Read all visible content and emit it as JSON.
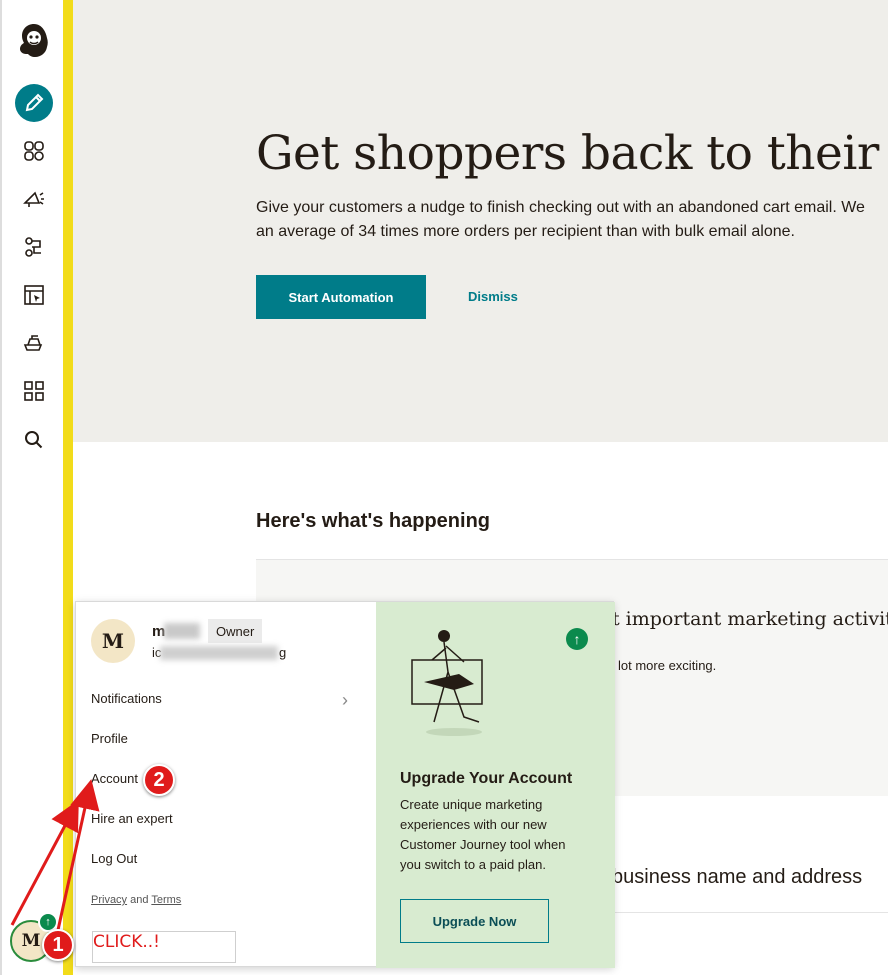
{
  "nav": {
    "icons": [
      "mailchimp-logo-icon",
      "create-pencil-icon",
      "audience-icon",
      "campaigns-icon",
      "automations-icon",
      "website-icon",
      "content-icon",
      "integrations-icon",
      "search-icon"
    ]
  },
  "hero": {
    "title": "Get shoppers back to their cart",
    "text_line1": "Give your customers a nudge to finish checking out with an abandoned cart email. We",
    "text_line2": "an average of 34 times more orders per recipient than with bulk email alone.",
    "start_label": "Start Automation",
    "dismiss_label": "Dismiss"
  },
  "main": {
    "section_title": "Here's what's happening",
    "activity_heading": "t important marketing activity",
    "activity_text": "lot more exciting.",
    "business_text": "business name and address"
  },
  "popup": {
    "avatar_letter": "M",
    "user_name": "m",
    "owner_badge": "Owner",
    "org_name": "ic",
    "org_suffix": "g",
    "menu": [
      "Notifications",
      "Profile",
      "Account",
      "Hire an expert",
      "Log Out"
    ],
    "legal_privacy": "Privacy",
    "legal_and": "and",
    "legal_terms": "Terms",
    "upgrade_title": "Upgrade Your Account",
    "upgrade_text": "Create unique marketing experiences with our new Customer Journey tool when you switch to a paid plan.",
    "upgrade_button": "Upgrade Now"
  },
  "annotations": {
    "step1": "1",
    "step2": "2",
    "click_text": "CLICK..!"
  },
  "colors": {
    "accent": "#007c89",
    "yellow": "#f2dc1a",
    "annotation_red": "#e01b1b",
    "upgrade_bg": "#d8ebd0",
    "success_green": "#0b8a4d"
  }
}
